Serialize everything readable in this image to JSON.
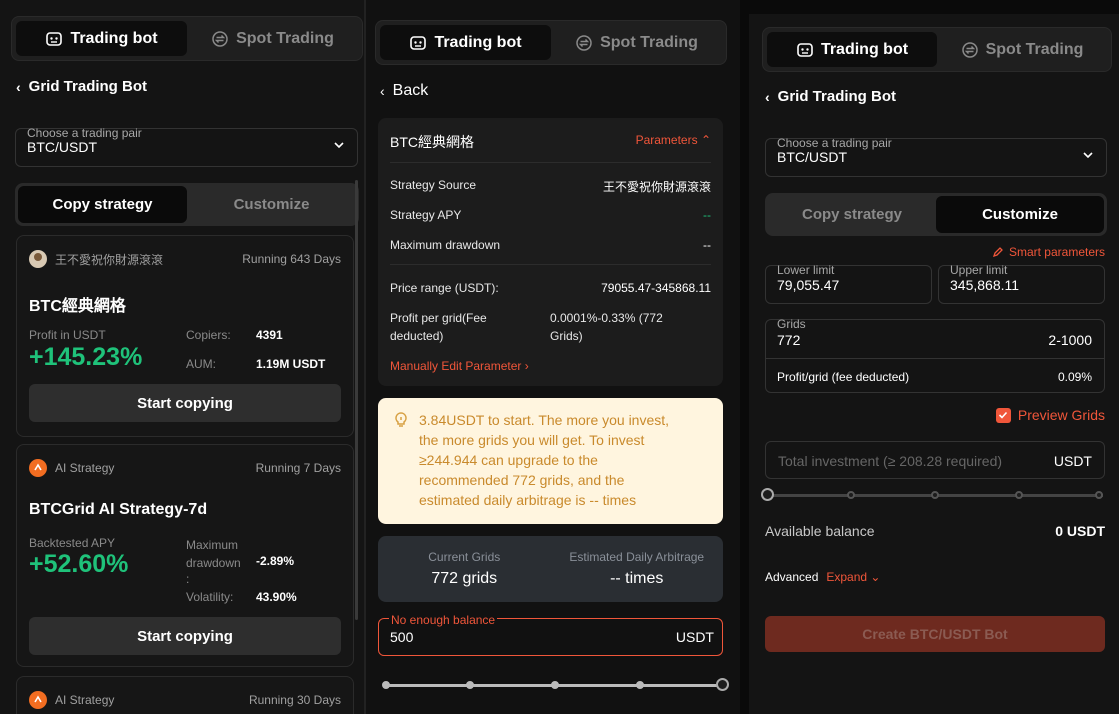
{
  "panel1": {
    "tabs": [
      {
        "label": "Trading bot"
      },
      {
        "label": "Spot Trading"
      }
    ],
    "back_label": "Grid Trading Bot",
    "pair_select": {
      "label": "Choose a trading pair",
      "value": "BTC/USDT"
    },
    "seg": [
      {
        "label": "Copy strategy"
      },
      {
        "label": "Customize"
      }
    ],
    "cards": [
      {
        "author": "王不愛祝你財源滾滾",
        "running": "Running 643 Days",
        "title": "BTC經典網格",
        "metric_label": "Profit in USDT",
        "metric_value": "+145.23%",
        "stat1_label": "Copiers:",
        "stat1_value": "4391",
        "stat2_label": "AUM:",
        "stat2_value": "1.19M USDT",
        "button": "Start copying"
      },
      {
        "author": "AI Strategy",
        "running": "Running 7 Days",
        "title": "BTCGrid AI Strategy-7d",
        "metric_label": "Backtested APY",
        "metric_value": "+52.60%",
        "stat1_label": "Maximum drawdown",
        "stat1_label_colon": ":",
        "stat1_value": "-2.89%",
        "stat2_label": "Volatility:",
        "stat2_value": "43.90%",
        "button": "Start copying"
      },
      {
        "author": "AI Strategy",
        "running": "Running 30 Days"
      }
    ]
  },
  "panel2": {
    "tabs": [
      {
        "label": "Trading bot"
      },
      {
        "label": "Spot Trading"
      }
    ],
    "back_label": "Back",
    "strategy_name": "BTC經典網格",
    "params_toggle": "Parameters",
    "rows": [
      {
        "label": "Strategy Source",
        "value": "王不愛祝你財源滾滾"
      },
      {
        "label": "Strategy APY",
        "value": "--"
      },
      {
        "label": "Maximum drawdown",
        "value": "--"
      }
    ],
    "price_range_label": "Price range (USDT):",
    "price_range_value": "79055.47-345868.11",
    "profit_grid_label_1": "Profit per grid(Fee",
    "profit_grid_label_2": "deducted)",
    "profit_grid_value_1": "0.0001%-0.33% (772",
    "profit_grid_value_2": "Grids)",
    "manual_edit": "Manually Edit Parameter",
    "notice_lines": [
      "3.84USDT to start. The more you invest,",
      "the more grids you will get. To invest",
      "≥244.944 can upgrade to the",
      "recommended 772 grids, and the",
      "estimated daily arbitrage is -- times"
    ],
    "current_grids_label": "Current Grids",
    "current_grids_value": "772 grids",
    "daily_arb_label": "Estimated Daily Arbitrage",
    "daily_arb_value": "-- times",
    "investment": {
      "error": "No enough balance",
      "value": "500",
      "unit": "USDT"
    },
    "slider_fraction": 1.0,
    "colors": {
      "accent": "#f0563a",
      "notice_bg": "#fff5df",
      "notice_text": "#c98a2c"
    }
  },
  "panel3": {
    "tabs": [
      {
        "label": "Trading bot"
      },
      {
        "label": "Spot Trading"
      }
    ],
    "back_label": "Grid Trading Bot",
    "pair_select": {
      "label": "Choose a trading pair",
      "value": "BTC/USDT"
    },
    "seg": [
      {
        "label": "Copy strategy"
      },
      {
        "label": "Customize"
      }
    ],
    "smart_params": "Smart parameters",
    "lower": {
      "label": "Lower limit",
      "value": "79,055.47"
    },
    "upper": {
      "label": "Upper limit",
      "value": "345,868.11"
    },
    "grids": {
      "label": "Grids",
      "value": "772",
      "range": "2-1000"
    },
    "profit_grid": {
      "label": "Profit/grid (fee deducted)",
      "value": "0.09%"
    },
    "preview_grids": "Preview Grids",
    "total_investment": {
      "placeholder": "Total investment (≥ 208.28 required)",
      "unit": "USDT"
    },
    "slider_fraction": 0.0,
    "available_label": "Available balance",
    "available_value": "0 USDT",
    "advanced_label": "Advanced",
    "expand_label": "Expand",
    "create_button": "Create BTC/USDT Bot",
    "colors": {
      "profit_green": "#1fc27a",
      "create_bg": "#6e2a1f"
    }
  }
}
